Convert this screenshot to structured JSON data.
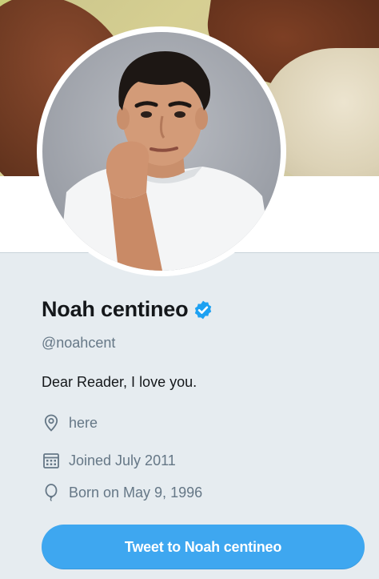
{
  "profile": {
    "name": "Noah centineo",
    "handle": "@noahcent",
    "bio": "Dear Reader, I love you.",
    "verified": true
  },
  "meta": {
    "location": "here",
    "joined": "Joined July 2011",
    "born": "Born on May 9, 1996"
  },
  "actions": {
    "tweet_to": "Tweet to Noah centineo"
  },
  "icons": {
    "verified": "verified-badge-icon",
    "location": "location-pin-icon",
    "joined": "calendar-icon",
    "born": "balloon-icon"
  },
  "colors": {
    "accent": "#1da1f2",
    "button": "#3ea7f0",
    "background": "#e6ecf0",
    "text_primary": "#14171a",
    "text_secondary": "#657786"
  }
}
